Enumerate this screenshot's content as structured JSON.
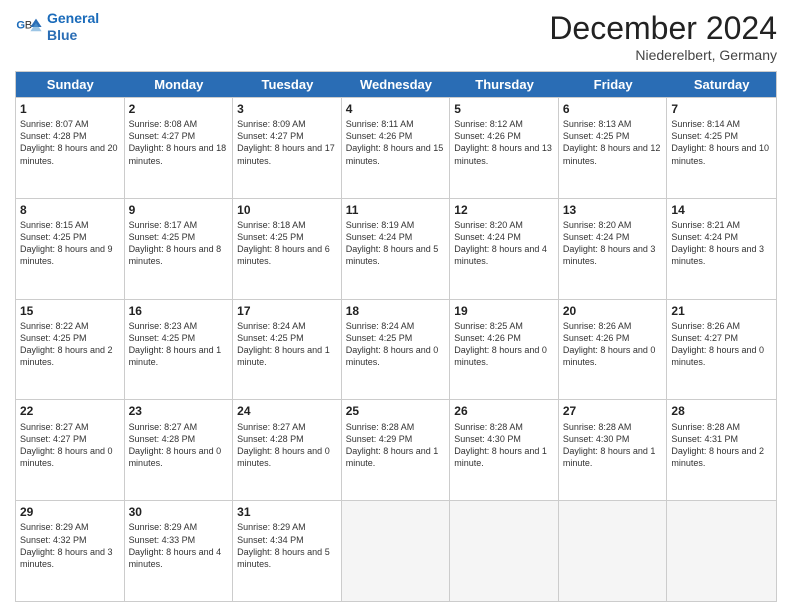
{
  "header": {
    "logo_line1": "General",
    "logo_line2": "Blue",
    "month": "December 2024",
    "location": "Niederelbert, Germany"
  },
  "days_of_week": [
    "Sunday",
    "Monday",
    "Tuesday",
    "Wednesday",
    "Thursday",
    "Friday",
    "Saturday"
  ],
  "weeks": [
    [
      {
        "day": 1,
        "sunrise": "8:07 AM",
        "sunset": "4:28 PM",
        "daylight": "8 hours and 20 minutes."
      },
      {
        "day": 2,
        "sunrise": "8:08 AM",
        "sunset": "4:27 PM",
        "daylight": "8 hours and 18 minutes."
      },
      {
        "day": 3,
        "sunrise": "8:09 AM",
        "sunset": "4:27 PM",
        "daylight": "8 hours and 17 minutes."
      },
      {
        "day": 4,
        "sunrise": "8:11 AM",
        "sunset": "4:26 PM",
        "daylight": "8 hours and 15 minutes."
      },
      {
        "day": 5,
        "sunrise": "8:12 AM",
        "sunset": "4:26 PM",
        "daylight": "8 hours and 13 minutes."
      },
      {
        "day": 6,
        "sunrise": "8:13 AM",
        "sunset": "4:25 PM",
        "daylight": "8 hours and 12 minutes."
      },
      {
        "day": 7,
        "sunrise": "8:14 AM",
        "sunset": "4:25 PM",
        "daylight": "8 hours and 10 minutes."
      }
    ],
    [
      {
        "day": 8,
        "sunrise": "8:15 AM",
        "sunset": "4:25 PM",
        "daylight": "8 hours and 9 minutes."
      },
      {
        "day": 9,
        "sunrise": "8:17 AM",
        "sunset": "4:25 PM",
        "daylight": "8 hours and 8 minutes."
      },
      {
        "day": 10,
        "sunrise": "8:18 AM",
        "sunset": "4:25 PM",
        "daylight": "8 hours and 6 minutes."
      },
      {
        "day": 11,
        "sunrise": "8:19 AM",
        "sunset": "4:24 PM",
        "daylight": "8 hours and 5 minutes."
      },
      {
        "day": 12,
        "sunrise": "8:20 AM",
        "sunset": "4:24 PM",
        "daylight": "8 hours and 4 minutes."
      },
      {
        "day": 13,
        "sunrise": "8:20 AM",
        "sunset": "4:24 PM",
        "daylight": "8 hours and 3 minutes."
      },
      {
        "day": 14,
        "sunrise": "8:21 AM",
        "sunset": "4:24 PM",
        "daylight": "8 hours and 3 minutes."
      }
    ],
    [
      {
        "day": 15,
        "sunrise": "8:22 AM",
        "sunset": "4:25 PM",
        "daylight": "8 hours and 2 minutes."
      },
      {
        "day": 16,
        "sunrise": "8:23 AM",
        "sunset": "4:25 PM",
        "daylight": "8 hours and 1 minute."
      },
      {
        "day": 17,
        "sunrise": "8:24 AM",
        "sunset": "4:25 PM",
        "daylight": "8 hours and 1 minute."
      },
      {
        "day": 18,
        "sunrise": "8:24 AM",
        "sunset": "4:25 PM",
        "daylight": "8 hours and 0 minutes."
      },
      {
        "day": 19,
        "sunrise": "8:25 AM",
        "sunset": "4:26 PM",
        "daylight": "8 hours and 0 minutes."
      },
      {
        "day": 20,
        "sunrise": "8:26 AM",
        "sunset": "4:26 PM",
        "daylight": "8 hours and 0 minutes."
      },
      {
        "day": 21,
        "sunrise": "8:26 AM",
        "sunset": "4:27 PM",
        "daylight": "8 hours and 0 minutes."
      }
    ],
    [
      {
        "day": 22,
        "sunrise": "8:27 AM",
        "sunset": "4:27 PM",
        "daylight": "8 hours and 0 minutes."
      },
      {
        "day": 23,
        "sunrise": "8:27 AM",
        "sunset": "4:28 PM",
        "daylight": "8 hours and 0 minutes."
      },
      {
        "day": 24,
        "sunrise": "8:27 AM",
        "sunset": "4:28 PM",
        "daylight": "8 hours and 0 minutes."
      },
      {
        "day": 25,
        "sunrise": "8:28 AM",
        "sunset": "4:29 PM",
        "daylight": "8 hours and 1 minute."
      },
      {
        "day": 26,
        "sunrise": "8:28 AM",
        "sunset": "4:30 PM",
        "daylight": "8 hours and 1 minute."
      },
      {
        "day": 27,
        "sunrise": "8:28 AM",
        "sunset": "4:30 PM",
        "daylight": "8 hours and 1 minute."
      },
      {
        "day": 28,
        "sunrise": "8:28 AM",
        "sunset": "4:31 PM",
        "daylight": "8 hours and 2 minutes."
      }
    ],
    [
      {
        "day": 29,
        "sunrise": "8:29 AM",
        "sunset": "4:32 PM",
        "daylight": "8 hours and 3 minutes."
      },
      {
        "day": 30,
        "sunrise": "8:29 AM",
        "sunset": "4:33 PM",
        "daylight": "8 hours and 4 minutes."
      },
      {
        "day": 31,
        "sunrise": "8:29 AM",
        "sunset": "4:34 PM",
        "daylight": "8 hours and 5 minutes."
      },
      null,
      null,
      null,
      null
    ]
  ]
}
